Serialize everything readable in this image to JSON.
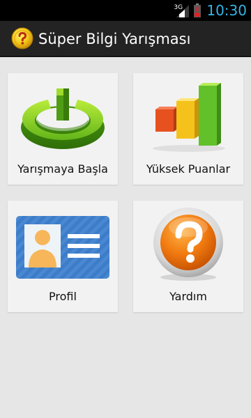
{
  "status_bar": {
    "network": "3G",
    "time": "10:30",
    "icons": [
      "signal-icon",
      "battery-low-icon"
    ]
  },
  "action_bar": {
    "title": "Süper Bilgi Yarışması",
    "icon": "question-coin-icon"
  },
  "menu": {
    "items": [
      {
        "label": "Yarışmaya Başla",
        "icon": "power-start-icon"
      },
      {
        "label": "Yüksek Puanlar",
        "icon": "bar-chart-icon"
      },
      {
        "label": "Profil",
        "icon": "profile-card-icon"
      },
      {
        "label": "Yardım",
        "icon": "help-question-icon"
      }
    ]
  },
  "colors": {
    "status_bar_bg": "#000000",
    "clock": "#33b5e5",
    "action_bar_bg": "#232323",
    "screen_bg": "#e6e6e6",
    "tile_bg": "#f2f2f2"
  }
}
